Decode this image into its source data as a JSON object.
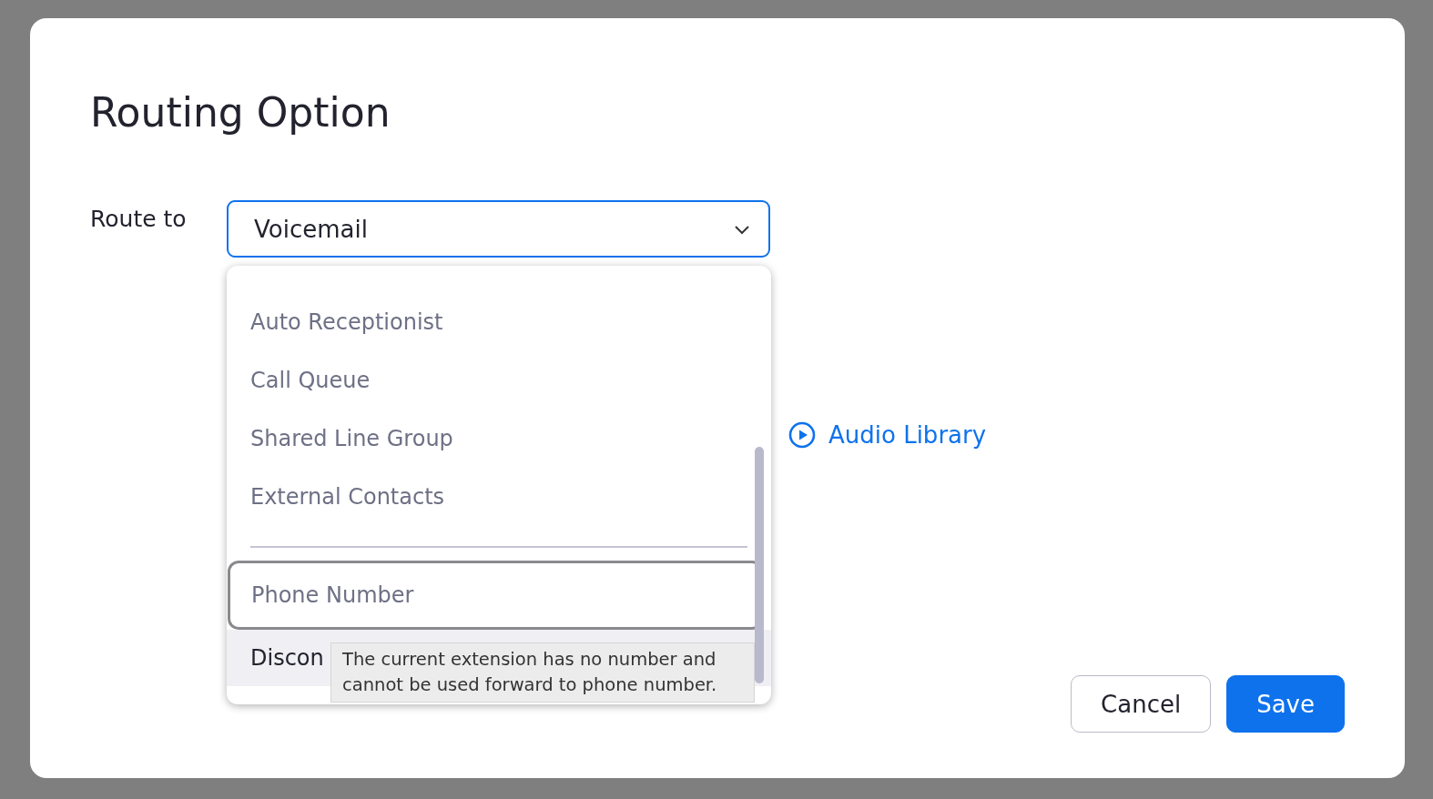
{
  "dialog": {
    "title": "Routing Option",
    "route_label": "Route to",
    "route_select": {
      "value": "Voicemail",
      "expanded": true
    },
    "options": [
      {
        "kind": "option",
        "label": "Auto Receptionist",
        "disabled": true,
        "focused": false,
        "highlighted": false
      },
      {
        "kind": "option",
        "label": "Call Queue",
        "disabled": true,
        "focused": false,
        "highlighted": false
      },
      {
        "kind": "option",
        "label": "Shared Line Group",
        "disabled": true,
        "focused": false,
        "highlighted": false
      },
      {
        "kind": "option",
        "label": "External Contacts",
        "disabled": true,
        "focused": false,
        "highlighted": false
      },
      {
        "kind": "divider"
      },
      {
        "kind": "option",
        "label": "Phone Number",
        "disabled": true,
        "focused": true,
        "highlighted": false
      },
      {
        "kind": "option",
        "label": "Discon",
        "disabled": false,
        "focused": false,
        "highlighted": true
      }
    ],
    "tooltip": "The current extension has no number and cannot be used forward to phone number.",
    "audio_library_link": "Audio Library",
    "buttons": [
      {
        "label": "Cancel",
        "kind": "secondary"
      },
      {
        "label": "Save",
        "kind": "primary"
      }
    ]
  }
}
